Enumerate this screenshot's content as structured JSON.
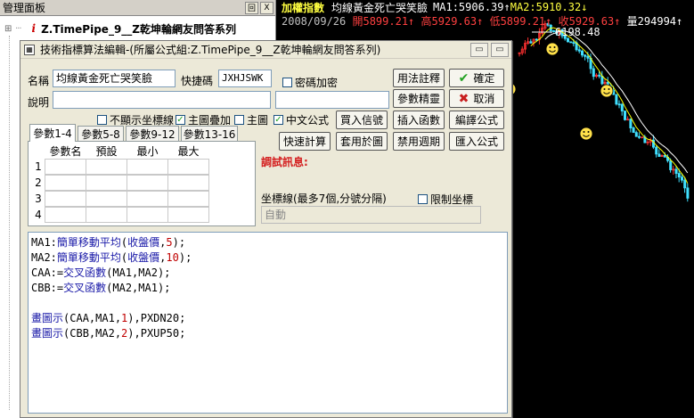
{
  "mgmt": {
    "title": "管理面板",
    "sys_buttons": [
      "回",
      "X"
    ],
    "tree_item": "Z.TimePipe_9__Z乾坤輪網友問答系列",
    "tree_icon": "i"
  },
  "chart": {
    "index_name": "加權指數",
    "formula_name": "均線黃金死亡哭笑臉",
    "ma1": "MA1:5906.39↑",
    "ma2": "MA2:5910.32↓",
    "date": "2008/09/26",
    "open": "開5899.21↑",
    "high": "高5929.63↑",
    "low": "低5899.21↑",
    "close": "收5929.63↑",
    "volume": "量294994↑",
    "volume_rest": "量",
    "price_marker": "6198.48",
    "colors": {
      "bg": "#000000",
      "up": "#ff3030",
      "down": "#40e0ff",
      "ma1": "#ffff00",
      "ma2": "#ffffff"
    }
  },
  "dialog": {
    "title": "技術指標算法編輯-(所屬公式組:Z.TimePipe_9__Z乾坤輪網友問答系列)",
    "name_label": "名稱",
    "name_value": "均線黃金死亡哭笑臉",
    "shortcut_label": "快捷碼",
    "shortcut_value": "JXHJSWK",
    "password_label": "密碼加密",
    "desc_label": "說明",
    "desc_value": "",
    "btn_usage": "用法註釋",
    "btn_ok": "確定",
    "btn_param_wizard": "參數精靈",
    "btn_cancel": "取消",
    "chk_hide_axis": "不顯示坐標線",
    "chk_overlay": "主圖疊加",
    "chk_main": "主圖",
    "chk_chinese": "中文公式",
    "btn_buy_signal": "買入信號",
    "btn_insert_func": "插入函數",
    "btn_compile": "編譯公式",
    "btn_quick_calc": "快速計算",
    "btn_apply_chart": "套用於圖",
    "btn_disable_period": "禁用週期",
    "btn_import": "匯入公式",
    "tabs": [
      "參數1-4",
      "參數5-8",
      "參數9-12",
      "參數13-16"
    ],
    "param_headers": [
      "參數名",
      "預設",
      "最小",
      "最大"
    ],
    "param_rows": [
      "1",
      "2",
      "3",
      "4"
    ],
    "debug_label": "調試訊息:",
    "axis_label": "坐標線(最多7個,分號分隔)",
    "limit_axis_label": "限制坐標",
    "axis_value": "自動"
  },
  "code": [
    [
      {
        "t": "MA1:",
        "c": "v"
      },
      {
        "t": "簡單移動平均",
        "c": "f"
      },
      {
        "t": "(",
        "c": "v"
      },
      {
        "t": "收盤價",
        "c": "f"
      },
      {
        "t": ",",
        "c": "v"
      },
      {
        "t": "5",
        "c": "n"
      },
      {
        "t": ");",
        "c": "v"
      }
    ],
    [
      {
        "t": "MA2:",
        "c": "v"
      },
      {
        "t": "簡單移動平均",
        "c": "f"
      },
      {
        "t": "(",
        "c": "v"
      },
      {
        "t": "收盤價",
        "c": "f"
      },
      {
        "t": ",",
        "c": "v"
      },
      {
        "t": "10",
        "c": "n"
      },
      {
        "t": ");",
        "c": "v"
      }
    ],
    [
      {
        "t": "CAA:=",
        "c": "v"
      },
      {
        "t": "交叉函數",
        "c": "f"
      },
      {
        "t": "(MA1,MA2);",
        "c": "v"
      }
    ],
    [
      {
        "t": "CBB:=",
        "c": "v"
      },
      {
        "t": "交叉函數",
        "c": "f"
      },
      {
        "t": "(MA2,MA1);",
        "c": "v"
      }
    ],
    [],
    [
      {
        "t": "畫圖示",
        "c": "f"
      },
      {
        "t": "(CAA,MA1,",
        "c": "v"
      },
      {
        "t": "1",
        "c": "n"
      },
      {
        "t": "),PXDN20;",
        "c": "v"
      }
    ],
    [
      {
        "t": "畫圖示",
        "c": "f"
      },
      {
        "t": "(CBB,MA2,",
        "c": "v"
      },
      {
        "t": "2",
        "c": "n"
      },
      {
        "t": "),PXUP50;",
        "c": "v"
      }
    ]
  ]
}
